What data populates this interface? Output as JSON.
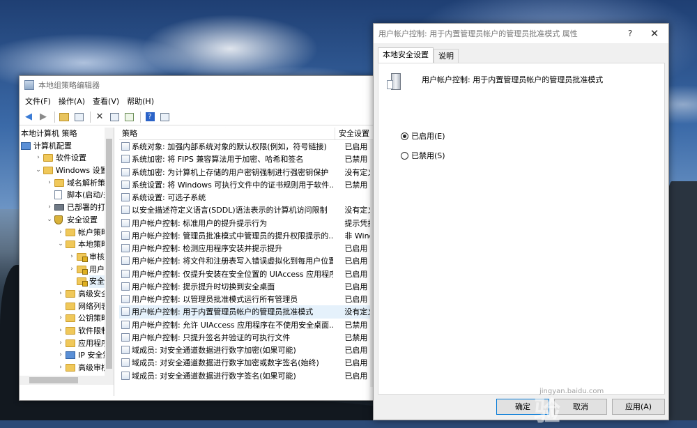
{
  "editor": {
    "title": "本地组策略编辑器",
    "menus": [
      "文件(F)",
      "操作(A)",
      "查看(V)",
      "帮助(H)"
    ],
    "tree_header": "本地计算机 策略",
    "tree": [
      {
        "label": "计算机配置",
        "icon": "computer-icon",
        "arrow": "",
        "indent": 0
      },
      {
        "label": "软件设置",
        "icon": "folder-icon",
        "arrow": ">",
        "indent": 1
      },
      {
        "label": "Windows 设置",
        "icon": "folder-icon",
        "arrow": "v",
        "indent": 1
      },
      {
        "label": "域名解析策略",
        "icon": "folder-icon",
        "arrow": ">",
        "indent": 2
      },
      {
        "label": "脚本(启动/关机",
        "icon": "script-icon",
        "arrow": "",
        "indent": 2
      },
      {
        "label": "已部署的打印机",
        "icon": "printer-icon",
        "arrow": ">",
        "indent": 2
      },
      {
        "label": "安全设置",
        "icon": "shield-icon",
        "arrow": "v",
        "indent": 2
      },
      {
        "label": "帐户策略",
        "icon": "folder-icon",
        "arrow": ">",
        "indent": 3
      },
      {
        "label": "本地策略",
        "icon": "folder-icon",
        "arrow": "v",
        "indent": 3
      },
      {
        "label": "审核策略",
        "icon": "locked-folder-icon",
        "arrow": ">",
        "indent": 4
      },
      {
        "label": "用户权限",
        "icon": "locked-folder-icon",
        "arrow": ">",
        "indent": 4
      },
      {
        "label": "安全选项",
        "icon": "locked-folder-icon",
        "arrow": "",
        "indent": 4,
        "selected": true
      },
      {
        "label": "高级安全 W",
        "icon": "folder-icon",
        "arrow": ">",
        "indent": 3
      },
      {
        "label": "网络列表管",
        "icon": "folder-icon",
        "arrow": "",
        "indent": 3
      },
      {
        "label": "公钥策略",
        "icon": "folder-icon",
        "arrow": ">",
        "indent": 3
      },
      {
        "label": "软件限制策",
        "icon": "folder-icon",
        "arrow": ">",
        "indent": 3
      },
      {
        "label": "应用程序控",
        "icon": "folder-icon",
        "arrow": ">",
        "indent": 3
      },
      {
        "label": "IP 安全策略",
        "icon": "ip-security-icon",
        "arrow": ">",
        "indent": 3
      },
      {
        "label": "高级审核策",
        "icon": "folder-icon",
        "arrow": ">",
        "indent": 3
      }
    ],
    "list_headers": {
      "policy": "策略",
      "setting": "安全设置"
    },
    "policies": [
      {
        "name": "系统对象: 加强内部系统对象的默认权限(例如，符号链接)",
        "setting": "已启用"
      },
      {
        "name": "系统加密: 将 FIPS 兼容算法用于加密、哈希和签名",
        "setting": "已禁用"
      },
      {
        "name": "系统加密: 为计算机上存储的用户密钥强制进行强密钥保护",
        "setting": "没有定义"
      },
      {
        "name": "系统设置: 将 Windows 可执行文件中的证书规则用于软件...",
        "setting": "已禁用"
      },
      {
        "name": "系统设置: 可选子系统",
        "setting": ""
      },
      {
        "name": "以安全描述符定义语言(SDDL)语法表示的计算机访问限制",
        "setting": "没有定义"
      },
      {
        "name": "用户帐户控制: 标准用户的提升提示行为",
        "setting": "提示凭据"
      },
      {
        "name": "用户帐户控制: 管理员批准模式中管理员的提升权限提示的...",
        "setting": "非 Windows"
      },
      {
        "name": "用户帐户控制: 检测应用程序安装并提示提升",
        "setting": "已启用"
      },
      {
        "name": "用户帐户控制: 将文件和注册表写入错误虚拟化到每用户位置",
        "setting": "已启用"
      },
      {
        "name": "用户帐户控制: 仅提升安装在安全位置的 UIAccess 应用程序",
        "setting": "已启用"
      },
      {
        "name": "用户帐户控制: 提示提升时切换到安全桌面",
        "setting": "已启用"
      },
      {
        "name": "用户帐户控制: 以管理员批准模式运行所有管理员",
        "setting": "已启用"
      },
      {
        "name": "用户帐户控制: 用于内置管理员帐户的管理员批准模式",
        "setting": "没有定义",
        "selected": true
      },
      {
        "name": "用户帐户控制: 允许 UIAccess 应用程序在不使用安全桌面...",
        "setting": "已禁用"
      },
      {
        "name": "用户帐户控制: 只提升签名并验证的可执行文件",
        "setting": "已禁用"
      },
      {
        "name": "域成员: 对安全通道数据进行数字加密(如果可能)",
        "setting": "已启用"
      },
      {
        "name": "域成员: 对安全通道数据进行数字加密或数字签名(始终)",
        "setting": "已启用"
      },
      {
        "name": "域成员: 对安全通道数据进行数字签名(如果可能)",
        "setting": "已启用"
      }
    ]
  },
  "dialog": {
    "title": "用户帐户控制: 用于内置管理员帐户的管理员批准模式 属性",
    "help": "?",
    "close": "✕",
    "tabs": [
      "本地安全设置",
      "说明"
    ],
    "policy_name": "用户帐户控制: 用于内置管理员帐户的管理员批准模式",
    "options": [
      {
        "label": "已启用(E)",
        "checked": true
      },
      {
        "label": "已禁用(S)",
        "checked": false
      }
    ],
    "buttons": {
      "ok": "确定",
      "cancel": "取消",
      "apply": "应用(A)"
    }
  },
  "watermark": {
    "logo": "Baidu经验",
    "url": "jingyan.baidu.com"
  },
  "colors": {
    "selection": "#e5f1fb",
    "accent": "#0078d7"
  }
}
